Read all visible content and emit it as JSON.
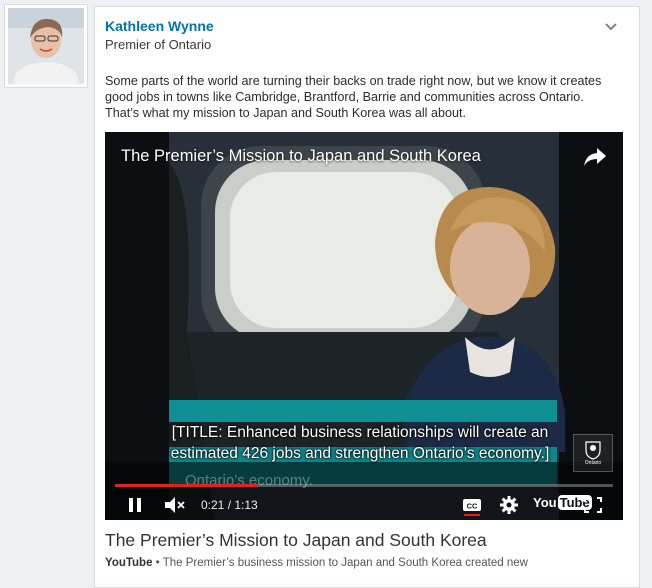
{
  "author": {
    "name": "Kathleen Wynne",
    "title": "Premier of Ontario"
  },
  "post": {
    "text": "Some parts of the world are turning their backs on trade right now, but we know it creates good jobs in towns like Cambridge, Brantford, Barrie and communities across Ontario. That’s what my mission to Japan and South Korea was all about."
  },
  "video": {
    "title": "The Premier’s Mission to Japan and South Korea",
    "caption_line1": "[TITLE: Enhanced business relationships will create an",
    "caption_line2": "estimated 426 jobs and strengthen Ontario’s economy.]",
    "caption_ghost": "Ontario’s economy.",
    "time": "0:21 / 1:13",
    "progress": 0.288,
    "yt_logo_you": "You",
    "yt_logo_tube": "Tube",
    "crest_text": "Ontario",
    "icons": [
      "share-icon",
      "pause-icon",
      "mute-icon",
      "closed-captions-icon",
      "settings-gear-icon",
      "youtube-logo",
      "fullscreen-icon",
      "chevron-down-icon"
    ]
  },
  "link": {
    "title": "The Premier’s Mission to Japan and South Korea",
    "source": "YouTube",
    "separator": " • ",
    "description": "The Premier’s business mission to Japan and South Korea created new"
  },
  "colors": {
    "link_blue": "#0073b1",
    "progress_red": "#e62117",
    "teal_banner": "#0f8f94"
  }
}
